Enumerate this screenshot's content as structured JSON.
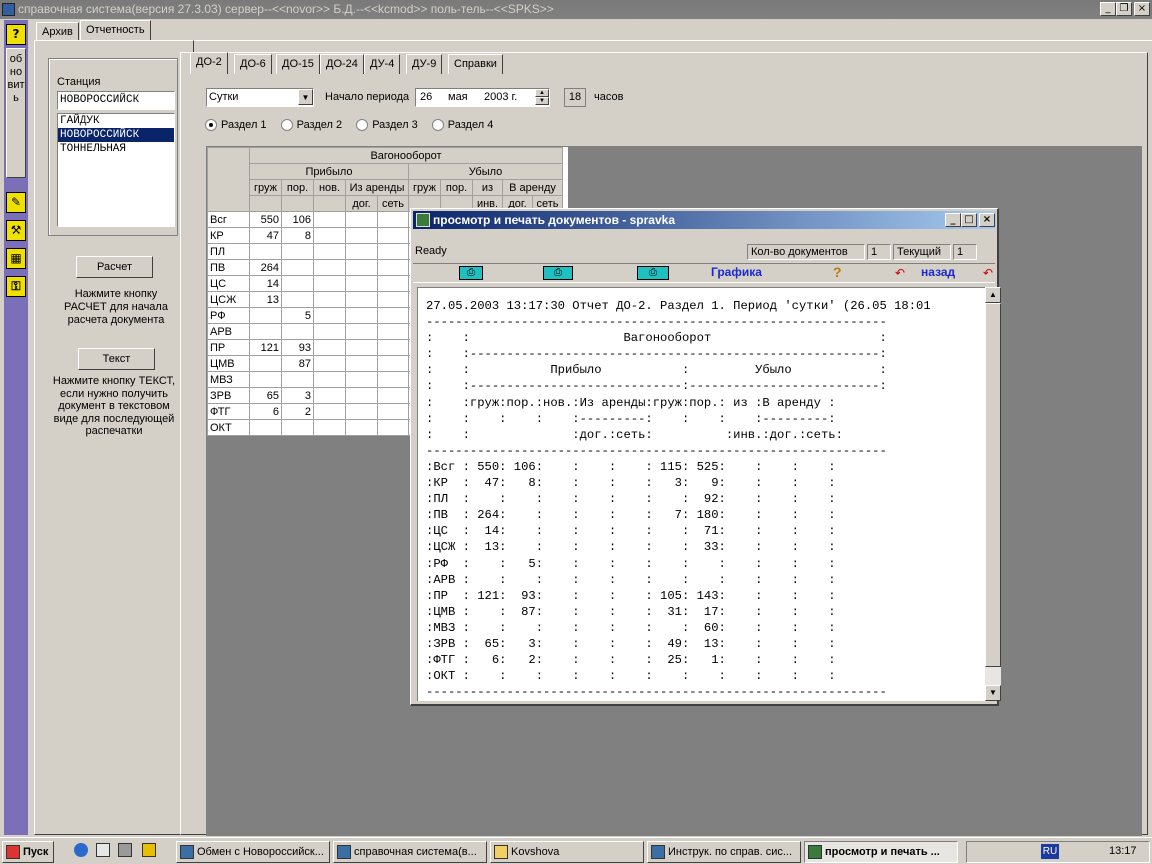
{
  "window": {
    "title": "справочная система(версия 27.3.03) сервер--<<novor>> Б.Д.--<<kcmod>> поль-тель--<<SPKS>>"
  },
  "left_toolbar": {
    "help": "?",
    "refresh": "обновить"
  },
  "top_tabs": [
    "Архив",
    "Отчетность"
  ],
  "station": {
    "label": "Станция",
    "value": "НОВОРОССИЙСК",
    "list": [
      "ГАЙДУК",
      "НОВОРОССИЙСК",
      "ТОННЕЛЬНАЯ"
    ],
    "selected_index": 1
  },
  "calc": {
    "button": "Расчет",
    "hint": "Нажмите кнопку РАСЧЕТ для начала расчета документа"
  },
  "text": {
    "button": "Текст",
    "hint": "Нажмите кнопку ТЕКСТ, если нужно получить документ в текстовом виде для последующей распечатки"
  },
  "doc_tabs": [
    "ДО-2",
    "ДО-6",
    "ДО-15",
    "ДО-24",
    "ДУ-4",
    "ДУ-9",
    "Справки"
  ],
  "period": {
    "type": "Сутки",
    "start_label": "Начало периода",
    "day": "26",
    "month": "мая",
    "year": "2003 г.",
    "hour": "18",
    "hours_label": "часов"
  },
  "sections": [
    "Раздел 1",
    "Раздел 2",
    "Раздел 3",
    "Раздел 4"
  ],
  "grid": {
    "header_main": "Вагонооборот",
    "arrived": "Прибыло",
    "departed": "Убыло",
    "cols_arrived": [
      "груж",
      "пор.",
      "нов.",
      "Из аренды"
    ],
    "cols_departed": [
      "груж",
      "пор.",
      "из",
      "В аренду"
    ],
    "sub_rent": [
      "дог.",
      "сеть"
    ],
    "sub_from": "инв.",
    "rows": [
      {
        "name": "Всг",
        "g": "550",
        "p": "106"
      },
      {
        "name": "КР",
        "g": "47",
        "p": "8"
      },
      {
        "name": "ПЛ",
        "g": "",
        "p": ""
      },
      {
        "name": "ПВ",
        "g": "264",
        "p": ""
      },
      {
        "name": "ЦС",
        "g": "14",
        "p": ""
      },
      {
        "name": "ЦСЖ",
        "g": "13",
        "p": ""
      },
      {
        "name": "РФ",
        "g": "",
        "p": "5"
      },
      {
        "name": "АРВ",
        "g": "",
        "p": ""
      },
      {
        "name": "ПР",
        "g": "121",
        "p": "93"
      },
      {
        "name": "ЦМВ",
        "g": "",
        "p": "87"
      },
      {
        "name": "МВЗ",
        "g": "",
        "p": ""
      },
      {
        "name": "ЗРВ",
        "g": "65",
        "p": "3"
      },
      {
        "name": "ФТГ",
        "g": "6",
        "p": "2"
      },
      {
        "name": "ОКТ",
        "g": "",
        "p": ""
      }
    ]
  },
  "child": {
    "title": "просмотр и печать документов - spravka",
    "status": "Ready",
    "doc_count_label": "Кол-во документов",
    "doc_count": "1",
    "current_label": "Текущий",
    "current": "1",
    "graphics": "Графика",
    "help": "?",
    "back": "назад",
    "report_text": "27.05.2003 13:17:30 Отчет ДО-2. Раздел 1. Период 'сутки' (26.05 18:01\n---------------------------------------------------------------\n:    :                     Вагонооборот                       :\n:    :--------------------------------------------------------:\n:    :           Прибыло           :         Убыло            :\n:    :-----------------------------:--------------------------:\n:    :груж:пор.:нов.:Из аренды:груж:пор.: из :В аренду :\n:    :    :    :    :---------:    :    :    :---------:\n:    :              :дог.:сеть:          :инв.:дог.:сеть:\n---------------------------------------------------------------\n:Всг : 550: 106:    :    :    : 115: 525:    :    :    :\n:КР  :  47:   8:    :    :    :   3:   9:    :    :    :\n:ПЛ  :    :    :    :    :    :    :  92:    :    :    :\n:ПВ  : 264:    :    :    :    :   7: 180:    :    :    :\n:ЦС  :  14:    :    :    :    :    :  71:    :    :    :\n:ЦСЖ :  13:    :    :    :    :    :  33:    :    :    :\n:РФ  :    :   5:    :    :    :    :    :    :    :    :\n:АРВ :    :    :    :    :    :    :    :    :    :    :\n:ПР  : 121:  93:    :    :    : 105: 143:    :    :    :\n:ЦМВ :    :  87:    :    :    :  31:  17:    :    :    :\n:МВЗ :    :    :    :    :    :    :  60:    :    :    :\n:ЗРВ :  65:   3:    :    :    :  49:  13:    :    :    :\n:ФТГ :   6:   2:    :    :    :  25:   1:    :    :    :\n:ОКТ :    :    :    :    :    :    :    :    :    :    :\n---------------------------------------------------------------"
  },
  "taskbar": {
    "start": "Пуск",
    "items": [
      "Обмен с Новороссийск...",
      "справочная система(в...",
      "Kovshova",
      "Инструк. по справ. сис...",
      "просмотр и печать ..."
    ],
    "lang": "RU",
    "clock": "13:17"
  }
}
